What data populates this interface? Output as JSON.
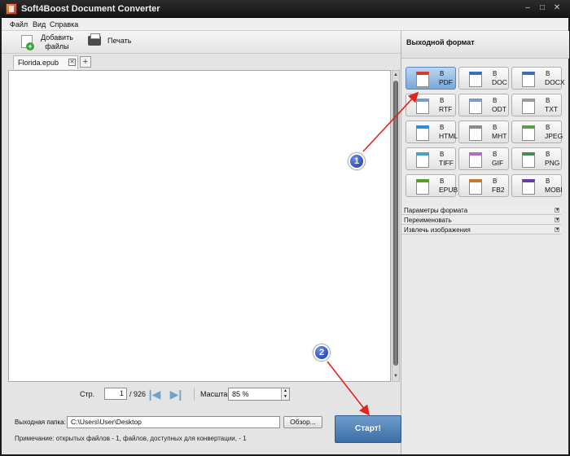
{
  "window": {
    "title": "Soft4Boost Document Converter",
    "controls": [
      "–",
      "□",
      "✕"
    ]
  },
  "menu": [
    "Файл",
    "Вид",
    "Справка"
  ],
  "toolbar": {
    "add_files": "Добавить файлы",
    "print": "Печать"
  },
  "document_tab": {
    "label": "Florida.epub"
  },
  "pager": {
    "page_label": "Стр.",
    "current_page": "1",
    "total": "/ 926",
    "zoom_label": "Масштаб",
    "zoom_value": "85 %"
  },
  "output": {
    "folder_label": "Выходная папка:",
    "folder_path": "C:\\Users\\User\\Desktop",
    "browse": "Обзор...",
    "start": "Старт!"
  },
  "note": "Примечание: открытых файлов - 1, файлов, доступных для конвертации, - 1",
  "right_panel": {
    "title": "Выходной формат",
    "formats": [
      {
        "prefix": "В",
        "name": "PDF",
        "icon": "pdf-icon",
        "selected": true,
        "color": "#d83a30"
      },
      {
        "prefix": "В",
        "name": "DOC",
        "icon": "doc-icon",
        "selected": false,
        "color": "#3a6fb8"
      },
      {
        "prefix": "В",
        "name": "DOCX",
        "icon": "docx-icon",
        "selected": false,
        "color": "#3a6fb8"
      },
      {
        "prefix": "В",
        "name": "RTF",
        "icon": "rtf-icon",
        "selected": false,
        "color": "#7a9cc7"
      },
      {
        "prefix": "В",
        "name": "ODT",
        "icon": "odt-icon",
        "selected": false,
        "color": "#7a9cc7"
      },
      {
        "prefix": "В",
        "name": "TXT",
        "icon": "txt-icon",
        "selected": false,
        "color": "#9a9a9a"
      },
      {
        "prefix": "В",
        "name": "HTML",
        "icon": "html-icon",
        "selected": false,
        "color": "#2a8fd8"
      },
      {
        "prefix": "В",
        "name": "MHT",
        "icon": "mht-icon",
        "selected": false,
        "color": "#8a8a8a"
      },
      {
        "prefix": "В",
        "name": "JPEG",
        "icon": "jpeg-icon",
        "selected": false,
        "color": "#5aa04a"
      },
      {
        "prefix": "В",
        "name": "TIFF",
        "icon": "tiff-icon",
        "selected": false,
        "color": "#4aa0c8"
      },
      {
        "prefix": "В",
        "name": "GIF",
        "icon": "gif-icon",
        "selected": false,
        "color": "#b06ac8"
      },
      {
        "prefix": "В",
        "name": "PNG",
        "icon": "png-icon",
        "selected": false,
        "color": "#4a8a5a"
      },
      {
        "prefix": "В",
        "name": "EPUB",
        "icon": "epub-icon",
        "selected": false,
        "color": "#5a9a2a"
      },
      {
        "prefix": "В",
        "name": "FB2",
        "icon": "fb2-icon",
        "selected": false,
        "color": "#c87a2a"
      },
      {
        "prefix": "В",
        "name": "MOBI",
        "icon": "mobi-icon",
        "selected": false,
        "color": "#6a3aa8"
      }
    ],
    "sections": [
      "Параметры формата",
      "Переименовать",
      "Извлечь изображения"
    ]
  },
  "annotations": {
    "step1": "1",
    "step2": "2",
    "arrow_color": "#e0241e"
  }
}
